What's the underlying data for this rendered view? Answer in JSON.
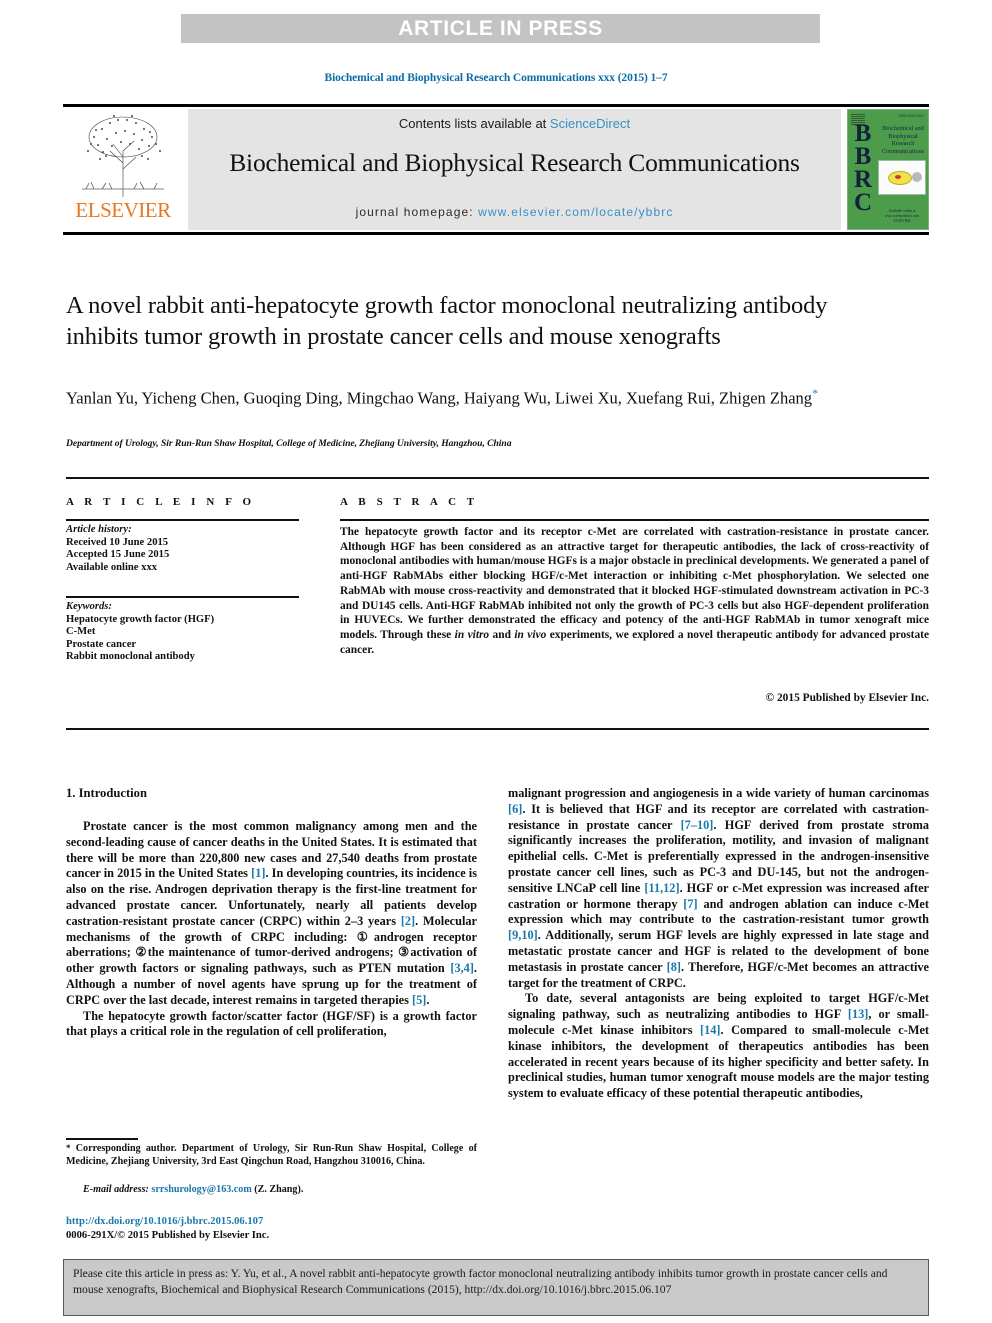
{
  "banner": {
    "label": "ARTICLE IN PRESS"
  },
  "running_head": "Biochemical and Biophysical Research Communications xxx (2015) 1–7",
  "masthead": {
    "contents_prefix": "Contents lists available at ",
    "sciencedirect": "ScienceDirect",
    "journal_name": "Biochemical and Biophysical Research Communications",
    "homepage_label": "journal homepage: ",
    "homepage_url": "www.elsevier.com/locate/ybbrc",
    "publisher_logo_text": "ELSEVIER",
    "cover": {
      "letters": "BBRC",
      "title": "Biochemical and Biophysical Research Communications",
      "top_right": "ISSN 0006-291X",
      "bottom": "Available online at www.sciencedirect.com  ELSEVIER"
    },
    "grey_hex": "#e4e4e4",
    "link_hex": "#3a8fc4",
    "elsevier_orange_hex": "#e87722",
    "cover_green_hex": "#4c9c4c"
  },
  "article": {
    "title": "A novel rabbit anti-hepatocyte growth factor monoclonal neutralizing antibody inhibits tumor growth in prostate cancer cells and mouse xenografts",
    "authors": "Yanlan Yu, Yicheng Chen, Guoqing Ding, Mingchao Wang, Haiyang Wu, Liwei Xu, Xuefang Rui, Zhigen Zhang",
    "corresponding_mark": "*",
    "affiliation": "Department of Urology, Sir Run-Run Shaw Hospital, College of Medicine, Zhejiang University, Hangzhou, China"
  },
  "article_info": {
    "heading": "A R T I C L E   I N F O",
    "history_label": "Article history:",
    "history": [
      "Received 10 June 2015",
      "Accepted 15 June 2015",
      "Available online xxx"
    ],
    "keywords_label": "Keywords:",
    "keywords": [
      "Hepatocyte growth factor (HGF)",
      "C-Met",
      "Prostate cancer",
      "Rabbit monoclonal antibody"
    ]
  },
  "abstract": {
    "heading": "A B S T R A C T",
    "text_part1": "The hepatocyte growth factor and its receptor c-Met are correlated with castration-resistance in prostate cancer. Although HGF has been considered as an attractive target for therapeutic antibodies, the lack of cross-reactivity of monoclonal antibodies with human/mouse HGFs is a major obstacle in preclinical developments. We generated a panel of anti-HGF RabMAbs either blocking HGF/c-Met interaction or inhibiting c-Met phosphorylation. We selected one RabMAb with mouse cross-reactivity and demonstrated that it blocked HGF-stimulated downstream activation in PC-3 and DU145 cells. Anti-HGF RabMAb inhibited not only the growth of PC-3 cells but also HGF-dependent proliferation in HUVECs. We further demonstrated the efficacy and potency of the anti-HGF RabMAb in tumor xenograft mice models. Through these ",
    "italic1": "in vitro",
    "text_part2": " and ",
    "italic2": "in vivo",
    "text_part3": " experiments, we explored a novel therapeutic antibody for advanced prostate cancer.",
    "copyright": "© 2015 Published by Elsevier Inc."
  },
  "body": {
    "section_heading": "1.  Introduction",
    "left_paragraphs": [
      {
        "parts": [
          {
            "t": "Prostate cancer is the most common malignancy among men and the second-leading cause of cancer deaths in the United States. It is estimated that there will be more than 220,800 new cases and 27,540 deaths from prostate cancer in 2015 in the United States "
          },
          {
            "t": "[1]",
            "ref": true
          },
          {
            "t": ". In developing countries, its incidence is also on the rise. Androgen deprivation therapy is the first-line treatment for advanced prostate cancer. Unfortunately, nearly all patients develop castration-resistant prostate cancer (CRPC) within 2–3 years "
          },
          {
            "t": "[2]",
            "ref": true
          },
          {
            "t": ". Molecular mechanisms of the growth of CRPC including: ①androgen receptor aberrations; ②the maintenance of tumor-derived androgens; ③activation of other growth factors or signaling pathways, such as PTEN mutation "
          },
          {
            "t": "[3,4]",
            "ref": true
          },
          {
            "t": ". Although a number of novel agents have sprung up for the treatment of CRPC over the last decade, interest remains in targeted therapies "
          },
          {
            "t": "[5]",
            "ref": true
          },
          {
            "t": "."
          }
        ]
      },
      {
        "parts": [
          {
            "t": "The hepatocyte growth factor/scatter factor (HGF/SF) is a growth factor that plays a critical role in the regulation of cell proliferation,"
          }
        ]
      }
    ],
    "right_paragraphs": [
      {
        "noindent": true,
        "parts": [
          {
            "t": "malignant progression and angiogenesis in a wide variety of human carcinomas "
          },
          {
            "t": "[6]",
            "ref": true
          },
          {
            "t": ". It is believed that HGF and its receptor are correlated with castration-resistance in prostate cancer "
          },
          {
            "t": "[7–10]",
            "ref": true
          },
          {
            "t": ". HGF derived from prostate stroma significantly increases the proliferation, motility, and invasion of malignant epithelial cells. C-Met is preferentially expressed in the androgen-insensitive prostate cancer cell lines, such as PC-3 and DU-145, but not the androgen-sensitive LNCaP cell line "
          },
          {
            "t": "[11,12]",
            "ref": true
          },
          {
            "t": ". HGF or c-Met expression was increased after castration or hormone therapy "
          },
          {
            "t": "[7]",
            "ref": true
          },
          {
            "t": " and androgen ablation can induce c-Met expression which may contribute to the castration-resistant tumor growth "
          },
          {
            "t": "[9,10]",
            "ref": true
          },
          {
            "t": ". Additionally, serum HGF levels are highly expressed in late stage and metastatic prostate cancer and HGF is related to the development of bone metastasis in prostate cancer "
          },
          {
            "t": "[8]",
            "ref": true
          },
          {
            "t": ". Therefore, HGF/c-Met becomes an attractive target for the treatment of CRPC."
          }
        ]
      },
      {
        "parts": [
          {
            "t": "To date, several antagonists are being exploited to target HGF/c-Met signaling pathway, such as neutralizing antibodies to HGF "
          },
          {
            "t": "[13]",
            "ref": true
          },
          {
            "t": ", or small-molecule c-Met kinase inhibitors "
          },
          {
            "t": "[14]",
            "ref": true
          },
          {
            "t": ". Compared to small-molecule c-Met kinase inhibitors, the development of therapeutics antibodies has been accelerated in recent years because of its higher specificity and better safety. In preclinical studies, human tumor xenograft mouse models are the major testing system to evaluate efficacy of these potential therapeutic antibodies,"
          }
        ]
      }
    ]
  },
  "footnote": {
    "star": "*",
    "text": " Corresponding author. Department of Urology, Sir Run-Run Shaw Hospital, College of Medicine, Zhejiang University, 3rd East Qingchun Road, Hangzhou 310016, China.",
    "email_label": "E-mail address:",
    "email": "srrshurology@163.com",
    "email_suffix": " (Z. Zhang)."
  },
  "imprint": {
    "doi": "http://dx.doi.org/10.1016/j.bbrc.2015.06.107",
    "issn_line": "0006-291X/© 2015 Published by Elsevier Inc."
  },
  "cite_box": {
    "text": "Please cite this article in press as: Y. Yu, et al., A novel rabbit anti-hepatocyte growth factor monoclonal neutralizing antibody inhibits tumor growth in prostate cancer cells and mouse xenografts, Biochemical and Biophysical Research Communications (2015), http://dx.doi.org/10.1016/j.bbrc.2015.06.107"
  }
}
